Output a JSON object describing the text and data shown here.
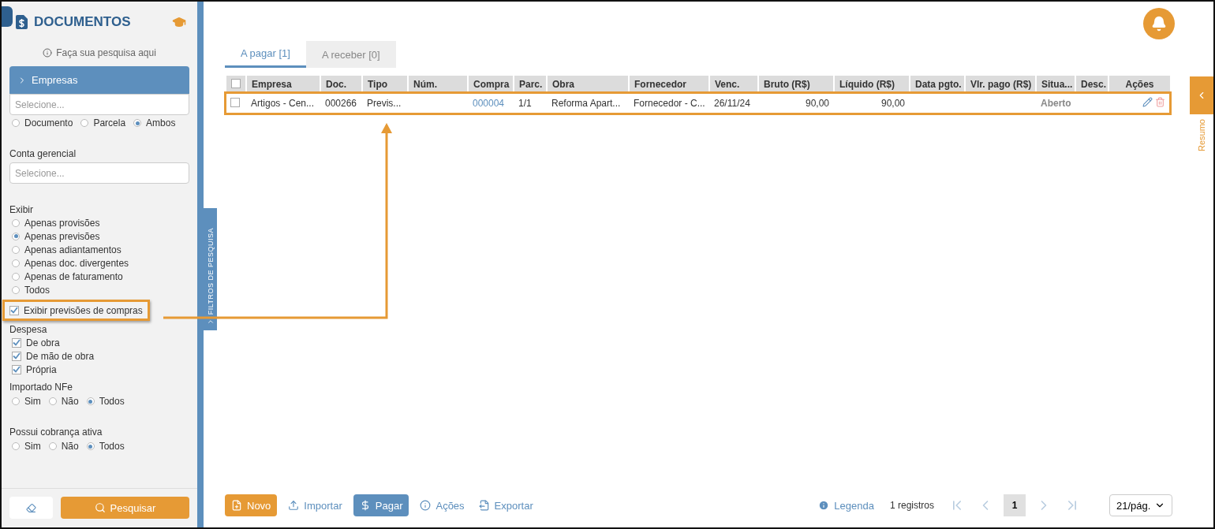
{
  "sidebar": {
    "title": "DOCUMENTOS",
    "hint": "Faça sua pesquisa aqui",
    "empresas": {
      "label": "Empresas",
      "expanded": false,
      "placeholder": "Selecione..."
    },
    "scope_options": [
      {
        "label": "Documento",
        "selected": false
      },
      {
        "label": "Parcela",
        "selected": false
      },
      {
        "label": "Ambos",
        "selected": true
      }
    ],
    "conta_gerencial": {
      "label": "Conta gerencial",
      "placeholder": "Selecione..."
    },
    "exibir": {
      "label": "Exibir",
      "options": [
        {
          "label": "Apenas provisões",
          "selected": false
        },
        {
          "label": "Apenas previsões",
          "selected": true
        },
        {
          "label": "Apenas adiantamentos",
          "selected": false
        },
        {
          "label": "Apenas doc. divergentes",
          "selected": false
        },
        {
          "label": "Apenas de faturamento",
          "selected": false
        },
        {
          "label": "Todos",
          "selected": false
        }
      ]
    },
    "purchase_forecasts": {
      "label": "Exibir previsões de compras",
      "checked": true,
      "highlighted": true
    },
    "despesa": {
      "label": "Despesa",
      "options": [
        {
          "label": "De obra",
          "checked": true
        },
        {
          "label": "De mão de obra",
          "checked": true
        },
        {
          "label": "Própria",
          "checked": true
        }
      ]
    },
    "importado_nfe": {
      "label": "Importado NFe",
      "options": [
        {
          "label": "Sim",
          "selected": false
        },
        {
          "label": "Não",
          "selected": false
        },
        {
          "label": "Todos",
          "selected": true
        }
      ]
    },
    "cobranca_ativa": {
      "label": "Possui cobrança ativa",
      "options": [
        {
          "label": "Sim",
          "selected": false
        },
        {
          "label": "Não",
          "selected": false
        },
        {
          "label": "Todos",
          "selected": true
        }
      ]
    },
    "search_button": "Pesquisar"
  },
  "filter_tab": "FILTROS DE PESQUISA",
  "tabs": [
    {
      "label": "A pagar [1]",
      "selected": true
    },
    {
      "label": "A receber [0]",
      "selected": false
    }
  ],
  "table": {
    "select_all_checked": false,
    "columns": [
      "Empresa",
      "Doc.",
      "Tipo",
      "Núm.",
      "Compra",
      "Parc.",
      "Obra",
      "Fornecedor",
      "Venc.",
      "Bruto (R$)",
      "Líquido (R$)",
      "Data pgto.",
      "Vlr. pago (R$)",
      "Situa...",
      "Desc.",
      "Ações"
    ],
    "rows": [
      {
        "checked": false,
        "highlighted": true,
        "cells": [
          "Artigos - Cen...",
          "000266",
          "Previs...",
          "",
          "000004",
          "1/1",
          "Reforma Apart...",
          "Fornecedor - C...",
          "26/11/24",
          "90,00",
          "90,00",
          "",
          "",
          "Aberto",
          ""
        ]
      }
    ]
  },
  "toolbar": [
    {
      "label": "Novo",
      "kind": "primary"
    },
    {
      "label": "Importar",
      "kind": "link"
    },
    {
      "label": "Pagar",
      "kind": "secondary"
    },
    {
      "label": "Ações",
      "kind": "link"
    },
    {
      "label": "Exportar",
      "kind": "link"
    }
  ],
  "pagination": {
    "legend": "Legenda",
    "count": "1 registros",
    "page": "1",
    "page_size": "21/pág."
  },
  "summary_tab": "Resumo"
}
